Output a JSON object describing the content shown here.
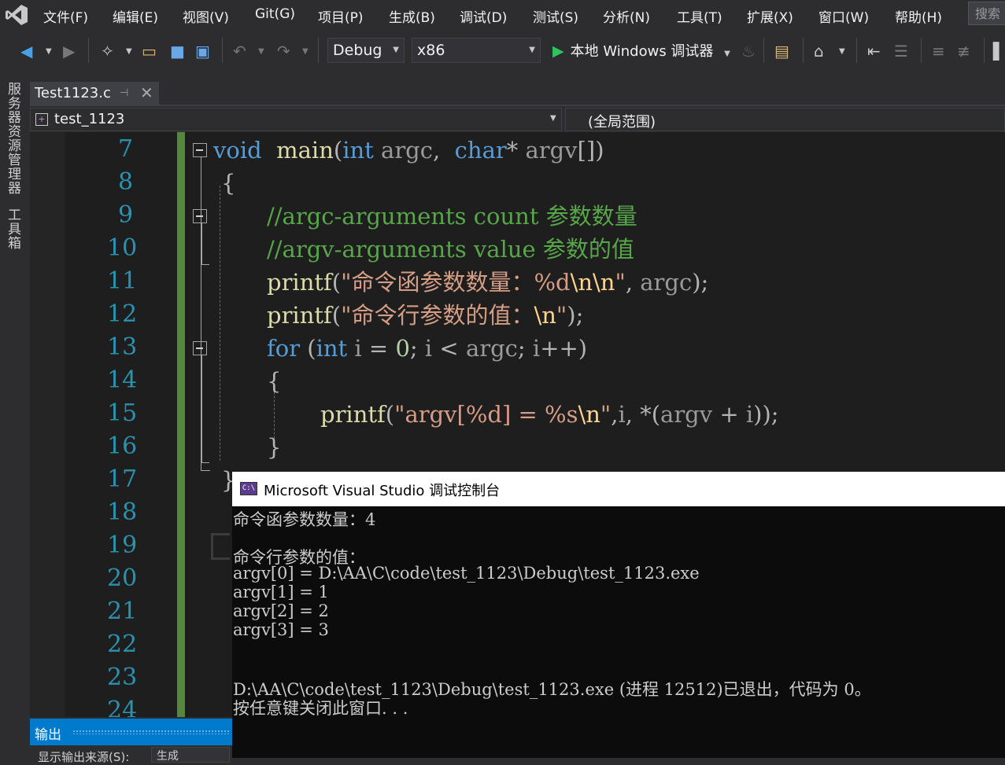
{
  "menu": [
    "文件(F)",
    "编辑(E)",
    "视图(V)",
    "Git(G)",
    "项目(P)",
    "生成(B)",
    "调试(D)",
    "测试(S)",
    "分析(N)",
    "工具(T)",
    "扩展(X)",
    "窗口(W)",
    "帮助(H)"
  ],
  "search": {
    "label": "搜索"
  },
  "toolbar": {
    "configuration": "Debug",
    "platform": "x86",
    "run_label": "本地 Windows 调试器"
  },
  "side_tabs": [
    "服务器资源管理器",
    "工具箱"
  ],
  "document_tab": {
    "label": "Test1123.c"
  },
  "navbar": {
    "file": "test_1123",
    "scope": "(全局范围)"
  },
  "editor": {
    "line_numbers": [
      "7",
      "8",
      "9",
      "10",
      "11",
      "12",
      "13",
      "14",
      "15",
      "16",
      "17",
      "18",
      "19",
      "20",
      "21",
      "22",
      "23",
      "24"
    ],
    "code": [
      {
        "parts": [
          [
            "kw",
            "void"
          ],
          [
            "",
            "  "
          ],
          [
            "fn",
            "main"
          ],
          [
            "op",
            "("
          ],
          [
            "kw",
            "int"
          ],
          [
            "param",
            " argc"
          ],
          [
            "op",
            ",  "
          ],
          [
            "kw",
            "char"
          ],
          [
            "op",
            "* "
          ],
          [
            "param",
            "argv"
          ],
          [
            "op",
            "[])"
          ]
        ]
      },
      {
        "parts": [
          [
            "op",
            "{"
          ]
        ]
      },
      {
        "parts": [
          [
            "cm",
            "//argc-arguments count 参数数量"
          ]
        ]
      },
      {
        "parts": [
          [
            "cm",
            "//argv-arguments value 参数的值"
          ]
        ]
      },
      {
        "parts": [
          [
            "fn",
            "printf"
          ],
          [
            "op",
            "("
          ],
          [
            "str",
            "\"命令函参数数量：%d"
          ],
          [
            "esc",
            "\\n\\n"
          ],
          [
            "str",
            "\""
          ],
          [
            "op",
            ", "
          ],
          [
            "param",
            "argc"
          ],
          [
            "op",
            ");"
          ]
        ]
      },
      {
        "parts": [
          [
            "fn",
            "printf"
          ],
          [
            "op",
            "("
          ],
          [
            "str",
            "\"命令行参数的值："
          ],
          [
            "esc",
            "\\n"
          ],
          [
            "str",
            "\""
          ],
          [
            "op",
            ");"
          ]
        ]
      },
      {
        "parts": [
          [
            "kw",
            "for"
          ],
          [
            "op",
            " ("
          ],
          [
            "kw",
            "int"
          ],
          [
            "param",
            " i"
          ],
          [
            "op",
            " = "
          ],
          [
            "num",
            "0"
          ],
          [
            "op",
            "; "
          ],
          [
            "param",
            "i"
          ],
          [
            "op",
            " < "
          ],
          [
            "param",
            "argc"
          ],
          [
            "op",
            "; "
          ],
          [
            "param",
            "i"
          ],
          [
            "op",
            "++)"
          ]
        ]
      },
      {
        "parts": [
          [
            "op",
            "{"
          ]
        ]
      },
      {
        "parts": [
          [
            "fn",
            "printf"
          ],
          [
            "op",
            "("
          ],
          [
            "str",
            "\"argv[%d] = %s"
          ],
          [
            "esc",
            "\\n"
          ],
          [
            "str",
            "\""
          ],
          [
            "op",
            ","
          ],
          [
            "param",
            "i"
          ],
          [
            "op",
            ", *("
          ],
          [
            "param",
            "argv"
          ],
          [
            "op",
            " + "
          ],
          [
            "param",
            "i"
          ],
          [
            "op",
            "));"
          ]
        ]
      },
      {
        "parts": [
          [
            "op",
            "}"
          ]
        ]
      },
      {
        "parts": [
          [
            "op",
            "}"
          ]
        ]
      }
    ]
  },
  "console": {
    "title": "Microsoft Visual Studio 调试控制台",
    "icon_text": "C:\\",
    "lines": [
      "命令函参数数量：4",
      "",
      "命令行参数的值：",
      "argv[0] = D:\\AA\\C\\code\\test_1123\\Debug\\test_1123.exe",
      "argv[1] = 1",
      "argv[2] = 2",
      "argv[3] = 3",
      "",
      "",
      "D:\\AA\\C\\code\\test_1123\\Debug\\test_1123.exe (进程 12512)已退出，代码为 0。",
      "按任意键关闭此窗口. . ."
    ]
  },
  "output": {
    "title": "输出",
    "source_label": "显示输出来源(S):",
    "source_value": "生成"
  }
}
